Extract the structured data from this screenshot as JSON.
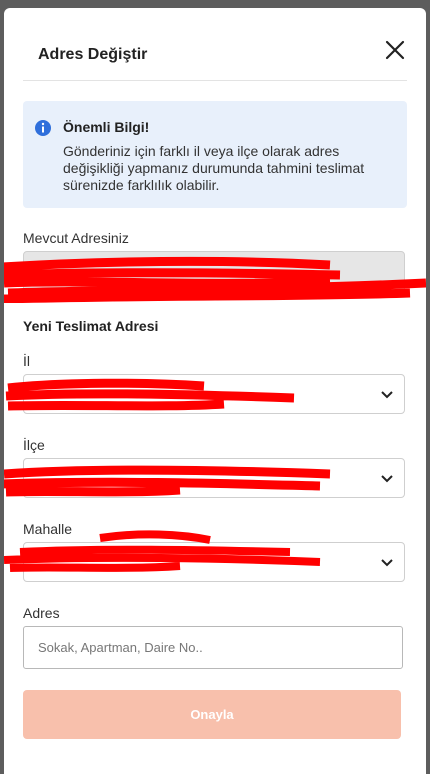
{
  "modal": {
    "title": "Adres Değiştir",
    "close_icon": "close-icon"
  },
  "info": {
    "icon": "info-icon",
    "title": "Önemli Bilgi!",
    "text": "Gönderiniz için farklı il veya ilçe olarak adres değişikliği yapmanız durumunda tahmini teslimat sürenizde farklılık olabilir."
  },
  "current": {
    "label": "Mevcut Adresiniz"
  },
  "new_address": {
    "heading": "Yeni Teslimat Adresi",
    "il_label": "İl",
    "ilce_label": "İlçe",
    "mahalle_label": "Mahalle",
    "adres_label": "Adres",
    "adres_placeholder": "Sokak, Apartman, Daire No.."
  },
  "submit": {
    "label": "Onayla"
  },
  "colors": {
    "accent_disabled": "#f8c0ac",
    "info_bg": "#e8f0fb",
    "info_icon": "#2f6fdb"
  }
}
